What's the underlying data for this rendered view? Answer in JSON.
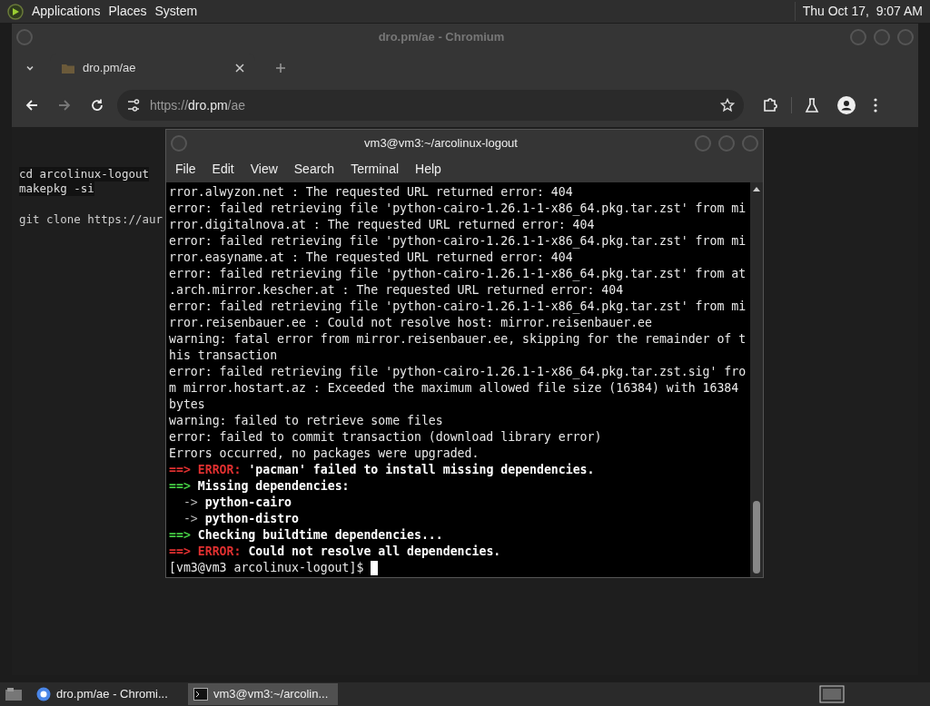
{
  "top_panel": {
    "menus": [
      "Applications",
      "Places",
      "System"
    ],
    "clock": "Thu Oct 17,  9:07 AM"
  },
  "browser": {
    "title": "dro.pm/ae - Chromium",
    "tabs": [
      {
        "title": "dro.pm/ae",
        "selected": true
      }
    ],
    "url": {
      "scheme": "https://",
      "host": "dro.pm",
      "path": "/ae"
    },
    "page_blocks": [
      {
        "highlighted": true,
        "lines": [
          "cd arcolinux-logout",
          "makepkg -si"
        ]
      },
      {
        "highlighted": false,
        "lines": [
          "git clone https://aur"
        ]
      }
    ]
  },
  "terminal": {
    "title": "vm3@vm3:~/arcolinux-logout",
    "menu": [
      "File",
      "Edit",
      "View",
      "Search",
      "Terminal",
      "Help"
    ],
    "lines": [
      {
        "kind": "plain",
        "text": "rror.alwyzon.net : The requested URL returned error: 404"
      },
      {
        "kind": "plain",
        "text": "error: failed retrieving file 'python-cairo-1.26.1-1-x86_64.pkg.tar.zst' from mi"
      },
      {
        "kind": "plain",
        "text": "rror.digitalnova.at : The requested URL returned error: 404"
      },
      {
        "kind": "plain",
        "text": "error: failed retrieving file 'python-cairo-1.26.1-1-x86_64.pkg.tar.zst' from mi"
      },
      {
        "kind": "plain",
        "text": "rror.easyname.at : The requested URL returned error: 404"
      },
      {
        "kind": "plain",
        "text": "error: failed retrieving file 'python-cairo-1.26.1-1-x86_64.pkg.tar.zst' from at"
      },
      {
        "kind": "plain",
        "text": ".arch.mirror.kescher.at : The requested URL returned error: 404"
      },
      {
        "kind": "plain",
        "text": "error: failed retrieving file 'python-cairo-1.26.1-1-x86_64.pkg.tar.zst' from mi"
      },
      {
        "kind": "plain",
        "text": "rror.reisenbauer.ee : Could not resolve host: mirror.reisenbauer.ee"
      },
      {
        "kind": "plain",
        "text": "warning: fatal error from mirror.reisenbauer.ee, skipping for the remainder of t"
      },
      {
        "kind": "plain",
        "text": "his transaction"
      },
      {
        "kind": "plain",
        "text": "error: failed retrieving file 'python-cairo-1.26.1-1-x86_64.pkg.tar.zst.sig' fro"
      },
      {
        "kind": "plain",
        "text": "m mirror.hostart.az : Exceeded the maximum allowed file size (16384) with 16384"
      },
      {
        "kind": "plain",
        "text": "bytes"
      },
      {
        "kind": "plain",
        "text": "warning: failed to retrieve some files"
      },
      {
        "kind": "plain",
        "text": "error: failed to commit transaction (download library error)"
      },
      {
        "kind": "plain",
        "text": "Errors occurred, no packages were upgraded."
      },
      {
        "kind": "error",
        "marker": "==>",
        "label": "ERROR:",
        "text": "'pacman' failed to install missing dependencies."
      },
      {
        "kind": "info",
        "marker": "==>",
        "text": "Missing dependencies:"
      },
      {
        "kind": "sub",
        "marker": "->",
        "text": "python-cairo"
      },
      {
        "kind": "sub",
        "marker": "->",
        "text": "python-distro"
      },
      {
        "kind": "info",
        "marker": "==>",
        "text": "Checking buildtime dependencies..."
      },
      {
        "kind": "error",
        "marker": "==>",
        "label": "ERROR:",
        "text": "Could not resolve all dependencies."
      },
      {
        "kind": "prompt",
        "text": "[vm3@vm3 arcolinux-logout]$"
      }
    ]
  },
  "taskbar": {
    "items": [
      {
        "kind": "browser",
        "label": "dro.pm/ae - Chromi...",
        "selected": false
      },
      {
        "kind": "terminal",
        "label": "vm3@vm3:~/arcolin...",
        "selected": true
      }
    ]
  }
}
